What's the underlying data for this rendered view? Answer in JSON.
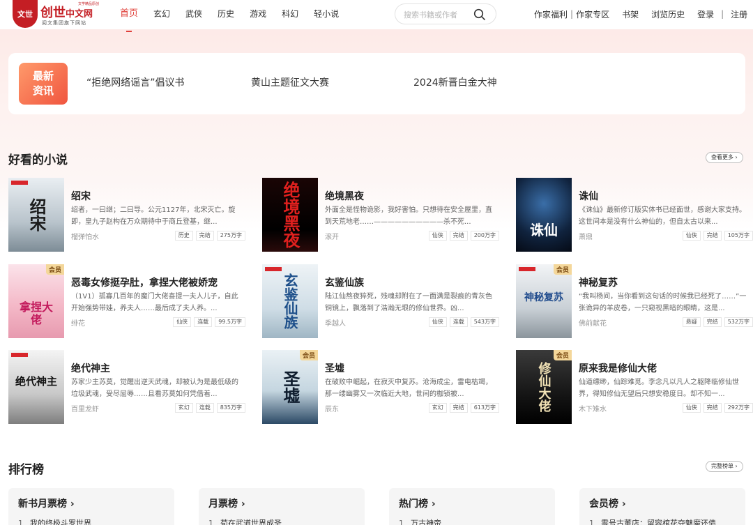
{
  "header": {
    "logo_seal": "文世",
    "logo_main": "创世",
    "logo_cn": "中文网",
    "logo_tiny": "文学精品原创",
    "logo_sub": "阅文集团旗下网站",
    "nav": [
      "首页",
      "玄幻",
      "武侠",
      "历史",
      "游戏",
      "科幻",
      "轻小说"
    ],
    "search_placeholder": "搜索书籍或作者",
    "links": [
      "作家福利",
      "作家专区",
      "书架",
      "浏览历史",
      "登录",
      "注册"
    ]
  },
  "news": {
    "badge_line1": "最新",
    "badge_line2": "资讯",
    "items": [
      "“拒绝网络谣言”倡议书",
      "黄山主题征文大赛",
      "2024新晋白金大神"
    ]
  },
  "good_novels": {
    "title": "好看的小说",
    "more": "查看更多 ›",
    "books": [
      {
        "title": "绍宋",
        "desc": "绍者，一曰继；二曰导。公元1127年，北宋灭亡。旋即，皇九子赵构在万众期待中于商丘登基，继...",
        "author": "榴弹怕水",
        "tags": [
          "历史",
          "完结",
          "275万字"
        ],
        "cover_text": "绍宋",
        "vip": ""
      },
      {
        "title": "绝境黑夜",
        "desc": "外面全是怪物诡影，我好害怕。只想待在安全屋里，直到天荒地老……——————————杀不死...",
        "author": "滚开",
        "tags": [
          "仙侠",
          "完结",
          "200万字"
        ],
        "cover_text": "绝境黑夜",
        "vip": ""
      },
      {
        "title": "诛仙",
        "desc": "《诛仙》最新修订版实体书已经面世，感谢大家支持。这世间本是没有什么神仙的，但自太古以来...",
        "author": "萧鼎",
        "tags": [
          "仙侠",
          "完结",
          "105万字"
        ],
        "cover_text": "诛仙",
        "vip": ""
      },
      {
        "title": "恶毒女修挺孕肚，拿捏大佬被娇宠",
        "desc": "（1V1）孤寡几百年的魔门大佬喜提一夫人儿子，自此开始强势带娃，养夫人……最后成了夫人养。...",
        "author": "绯花",
        "tags": [
          "仙侠",
          "连载",
          "99.5万字"
        ],
        "cover_text": "拿捏大佬",
        "vip": "会员"
      },
      {
        "title": "玄鉴仙族",
        "desc": "陆江仙熬夜猝死，残魂却附在了一面满是裂痕的青灰色铜镜上，飘落到了浩瀚无垠的修仙世界。凶...",
        "author": "季越人",
        "tags": [
          "仙侠",
          "连载",
          "543万字"
        ],
        "cover_text": "玄鉴仙族",
        "vip": ""
      },
      {
        "title": "神秘复苏",
        "desc": "“我叫杨间，当你看到这句话的时候我已经死了……”一张诡异的羊皮卷，一只窥视黑暗的眼睛，这是...",
        "author": "佛前献花",
        "tags": [
          "悬疑",
          "完结",
          "532万字"
        ],
        "cover_text": "神秘复苏",
        "vip": "会员"
      },
      {
        "title": "绝代神主",
        "desc": "苏家少主苏莫，觉醒出逆天武魂，却被认为是最低级的垃圾武魂，受尽屈辱……且看苏莫如何凭借着...",
        "author": "百里龙虾",
        "tags": [
          "玄幻",
          "连载",
          "835万字"
        ],
        "cover_text": "绝代神主",
        "vip": ""
      },
      {
        "title": "圣墟",
        "desc": "在破败中崛起，在寂灭中复苏。沧海成尘，雷电枯竭，那一缕幽雾又一次临近大地，世间的枷锁被...",
        "author": "辰东",
        "tags": [
          "玄幻",
          "完结",
          "613万字"
        ],
        "cover_text": "圣墟",
        "vip": "会员"
      },
      {
        "title": "原来我是修仙大佬",
        "desc": "仙道缥缈，仙踪难觅。李念凡以凡人之躯降临修仙世界，得知修仙无望后只想安稳度日。却不知一...",
        "author": "木下雉水",
        "tags": [
          "仙侠",
          "完结",
          "292万字"
        ],
        "cover_text": "修仙大佬",
        "vip": "会员"
      }
    ]
  },
  "rankings": {
    "title": "排行榜",
    "more": "完整榜单 ›",
    "lists": [
      {
        "title": "新书月票榜 ›",
        "first_rank": "1",
        "first": "我的终极斗罗世界"
      },
      {
        "title": "月票榜 ›",
        "first_rank": "1",
        "first": "苟在武道世界成圣"
      },
      {
        "title": "热门榜 ›",
        "first_rank": "1",
        "first": "万古神帝"
      },
      {
        "title": "会员榜 ›",
        "first_rank": "1",
        "first": "零号古董店：留容棺花夺魅魔还债"
      }
    ]
  },
  "colors": {
    "accent": "#e0403a",
    "brand": "#c41e24"
  }
}
